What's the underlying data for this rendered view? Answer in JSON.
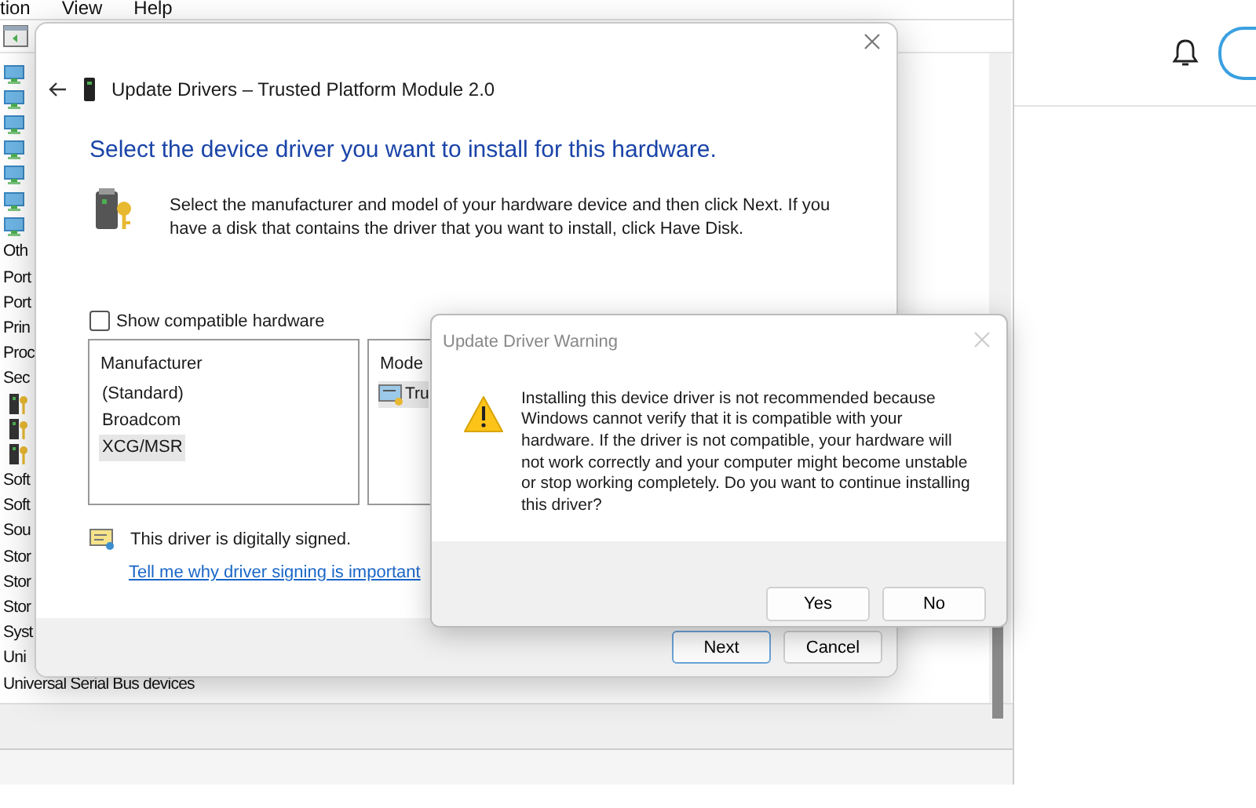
{
  "background_app": {
    "menu": [
      "tion",
      "View",
      "Help"
    ],
    "tree_items": [
      {
        "kind": "monitor"
      },
      {
        "kind": "monitor"
      },
      {
        "kind": "monitor"
      },
      {
        "kind": "monitor"
      },
      {
        "kind": "monitor"
      },
      {
        "kind": "monitor"
      },
      {
        "kind": "monitor"
      },
      {
        "kind": "text",
        "label": "Oth"
      },
      {
        "kind": "text",
        "label": "Port"
      },
      {
        "kind": "text",
        "label": "Port"
      },
      {
        "kind": "text",
        "label": "Prin"
      },
      {
        "kind": "text",
        "label": "Proc"
      },
      {
        "kind": "text",
        "label": "Sec",
        "children": [
          {
            "kind": "key"
          },
          {
            "kind": "key"
          },
          {
            "kind": "key"
          }
        ]
      },
      {
        "kind": "text",
        "label": "Soft"
      },
      {
        "kind": "text",
        "label": "Soft"
      },
      {
        "kind": "text",
        "label": "Sou"
      },
      {
        "kind": "text",
        "label": "Stor"
      },
      {
        "kind": "text",
        "label": "Stor"
      },
      {
        "kind": "text",
        "label": "Stor"
      },
      {
        "kind": "text",
        "label": "Syst"
      },
      {
        "kind": "text",
        "label": "Uni"
      },
      {
        "kind": "text",
        "label": "Universal Serial Bus devices"
      }
    ]
  },
  "driver_dialog": {
    "title": "Update Drivers – Trusted Platform Module 2.0",
    "heading": "Select the device driver you want to install for this hardware.",
    "description": "Select the manufacturer and model of your hardware device and then click Next. If you have a disk that contains the driver that you want to install, click Have Disk.",
    "show_compatible": {
      "label": "Show compatible hardware",
      "checked": false
    },
    "manufacturer_list": {
      "header": "Manufacturer",
      "items": [
        {
          "label": "(Standard)",
          "selected": false
        },
        {
          "label": "Broadcom",
          "selected": false
        },
        {
          "label": "XCG/MSR",
          "selected": true
        }
      ]
    },
    "model_list": {
      "header": "Mode",
      "items": [
        {
          "label": "Tru",
          "selected": true
        }
      ]
    },
    "signed_text": "This driver is digitally signed.",
    "signing_link": "Tell me why driver signing is important",
    "buttons": [
      {
        "label": "Next",
        "default": true
      },
      {
        "label": "Cancel",
        "default": false
      }
    ]
  },
  "warning_dialog": {
    "title": "Update Driver Warning",
    "message": "Installing this device driver is not recommended because Windows cannot verify that it is compatible with your hardware.  If the driver is not compatible, your hardware will not work correctly and your computer might become unstable or stop working completely.  Do you want to continue installing this driver?",
    "buttons": [
      {
        "label": "Yes"
      },
      {
        "label": "No"
      }
    ]
  }
}
